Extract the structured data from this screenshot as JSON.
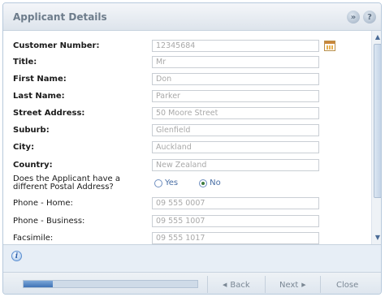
{
  "dialog": {
    "title": "Applicant Details",
    "collapse_icon": "double-chevron-down-icon",
    "help_icon": "question-icon"
  },
  "form": {
    "customer_number": {
      "label": "Customer Number:",
      "value": "12345684"
    },
    "title": {
      "label": "Title:",
      "value": "Mr"
    },
    "first_name": {
      "label": "First Name:",
      "value": "Don"
    },
    "last_name": {
      "label": "Last Name:",
      "value": "Parker"
    },
    "street_address": {
      "label": "Street Address:",
      "value": "50 Moore Street"
    },
    "suburb": {
      "label": "Suburb:",
      "value": "Glenfield"
    },
    "city": {
      "label": "City:",
      "value": "Auckland"
    },
    "country": {
      "label": "Country:",
      "value": "New Zealand"
    },
    "postal_question": {
      "label": "Does the Applicant have a different Postal Address?",
      "options": [
        "Yes",
        "No"
      ],
      "selected": "No"
    },
    "phone_home": {
      "label": "Phone - Home:",
      "value": "09 555 0007"
    },
    "phone_business": {
      "label": "Phone - Business:",
      "value": "09 555 1007"
    },
    "facsimile": {
      "label": "Facsimile:",
      "value": "09 555 1017"
    }
  },
  "info": {
    "icon": "info-icon"
  },
  "footer": {
    "progress": 0.17,
    "back_label": "Back",
    "next_label": "Next",
    "close_label": "Close",
    "back_arrow": "◀",
    "next_arrow": "▶"
  },
  "colors": {
    "accent": "#3f72b5",
    "title_text": "#6d7c8b",
    "field_text": "#a9a9a9"
  }
}
